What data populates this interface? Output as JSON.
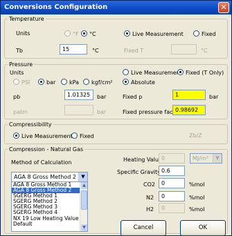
{
  "window": {
    "title": "Conversions Configuration",
    "close_glyph": "✕"
  },
  "temperature": {
    "legend": "Temperature",
    "units_label": "Units",
    "unit_options": [
      "°F",
      "°C"
    ],
    "selected_unit": "°C",
    "mode_options": [
      "Live Measurement",
      "Fixed"
    ],
    "selected_mode": "Live Measurement",
    "tb_label": "Tb",
    "tb_value": "15",
    "tb_unit": "°C",
    "fixed_t_label": "Fixed T",
    "fixed_t_value": "",
    "fixed_t_unit": "°C"
  },
  "pressure": {
    "legend": "Pressure",
    "units_label": "Units",
    "unit_options": [
      "PSI",
      "bar",
      "kPa",
      "kgf/cm²"
    ],
    "selected_unit": "bar",
    "mode_options": [
      "Live Measurement",
      "Fixed (T Only)"
    ],
    "selected_mode": "Fixed (T Only)",
    "absolute_label": "Absolute",
    "pb_label": "pb",
    "pb_value": "1.01325",
    "pb_unit": "bar",
    "patm_label": "patm",
    "patm_value": "",
    "patm_unit": "bar",
    "fixed_p_label": "Fixed p",
    "fixed_p_value": "1",
    "fixed_p_unit": "bar",
    "fixed_factor_label": "Fixed pressure factor",
    "fixed_factor_value": "0.98692"
  },
  "compressibility": {
    "legend": "Compressibility",
    "options": [
      "Live Measurement",
      "Fixed"
    ],
    "selected": "Live Measurement",
    "zb_z_label": "Zb/Z"
  },
  "gas": {
    "legend": "Compression - Natural Gas",
    "method_label": "Method of Calculation",
    "selected_method": "AGA 8 Gross Method 2",
    "methods": [
      "AGA 8 Gross Method 1",
      "AGA 8 Gross Method 2",
      "SGERG Method 1",
      "SGERG Method 2",
      "SGERG Method 3",
      "SGERG Method 4",
      "NX 19 Low Heating Value",
      "Default"
    ],
    "heating_value_label": "Heating Value",
    "heating_value": "0",
    "heating_unit": "MJ/m³",
    "specific_gravity_label": "Specific Gravity",
    "specific_gravity": "0.6",
    "co2_label": "CO2",
    "co2_value": "0",
    "co2_unit": "%mol",
    "n2_label": "N2",
    "n2_value": "0",
    "n2_unit": "%mol",
    "h2_label": "H2",
    "h2_value": "0",
    "h2_unit": "%mol"
  },
  "buttons": {
    "cancel": "Cancel",
    "ok": "OK"
  }
}
